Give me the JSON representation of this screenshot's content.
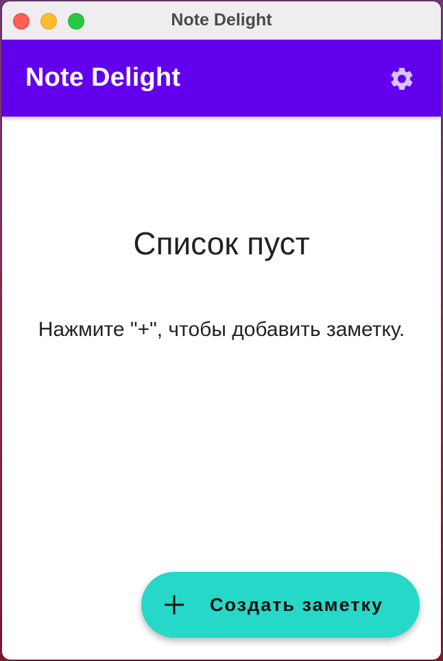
{
  "window": {
    "title": "Note Delight"
  },
  "app_bar": {
    "title": "Note Delight",
    "background_color": "#6200ee",
    "settings_icon": "gear-icon"
  },
  "empty_state": {
    "title": "Список пуст",
    "hint": "Нажмите \"+\", чтобы добавить заметку."
  },
  "fab": {
    "icon": "plus-icon",
    "label": "Создать заметку",
    "background_color": "#26d8c8"
  }
}
